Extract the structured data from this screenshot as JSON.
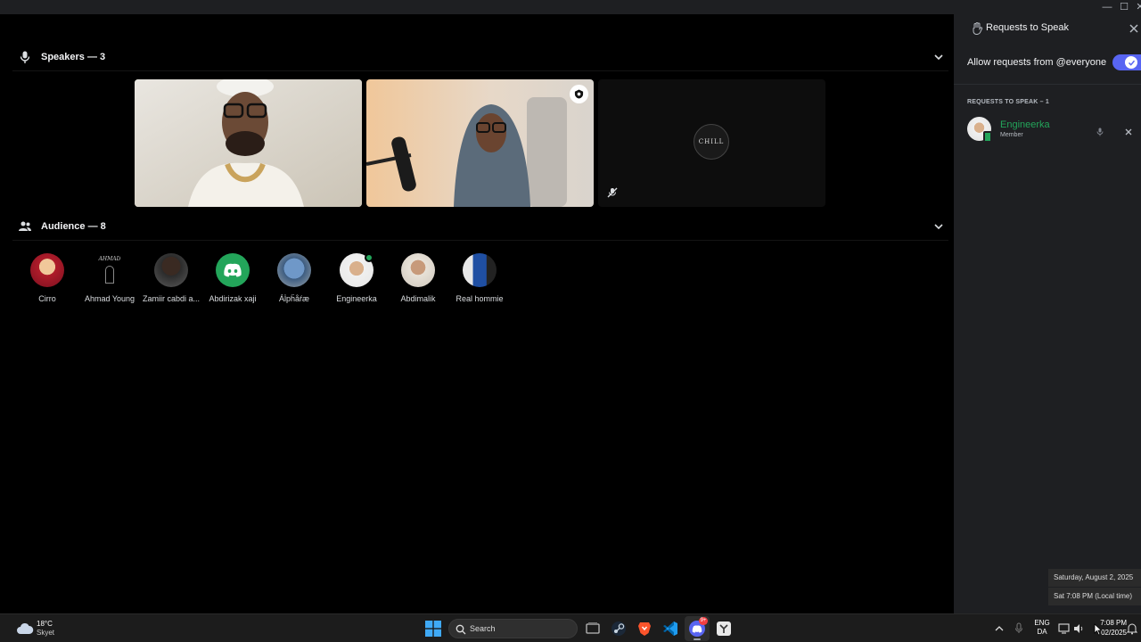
{
  "window": {
    "minimize_glyph": "—",
    "maximize_glyph": "☐",
    "close_glyph": "✕"
  },
  "stage": {
    "speakers_label": "Speakers — 3",
    "audience_label": "Audience — 8",
    "speakers": [
      {
        "name": "speaker-1",
        "kind": "video"
      },
      {
        "name": "speaker-2",
        "kind": "video",
        "badge": "moderator-shield-icon"
      },
      {
        "name": "speaker-3",
        "kind": "avatar",
        "avatar_text": "CHILL",
        "muted": true
      }
    ],
    "audience": [
      {
        "name": "Cirro"
      },
      {
        "name": "Ahmad Young",
        "avatar_text": "AHMAD"
      },
      {
        "name": "Zamiir cabdi a..."
      },
      {
        "name": "Abdirizak xaji"
      },
      {
        "name": "Áĺpĥåŕæ"
      },
      {
        "name": "Engineerka"
      },
      {
        "name": "Abdimalik"
      },
      {
        "name": "Real hommie"
      }
    ]
  },
  "panel": {
    "title": "Requests to Speak",
    "allow_label": "Allow requests from @everyone",
    "allow_enabled": true,
    "requests_header": "REQUESTS TO SPEAK – 1",
    "requests": [
      {
        "name": "Engineerka",
        "role": "Member"
      }
    ]
  },
  "taskbar": {
    "weather_temp": "18°C",
    "weather_desc": "Skyet",
    "search_placeholder": "Search",
    "discord_badge": "9+",
    "lang_top": "ENG",
    "lang_bottom": "DA",
    "clock_time": "7:08 PM",
    "clock_date": "02/2025",
    "tooltip_date": "Saturday, August 2, 2025",
    "tooltip_local": "Sat 7:08 PM (Local time)"
  },
  "colors": {
    "accent": "#5865f2",
    "member_green": "#23a55a",
    "panel_bg": "#1e1f22",
    "stage_bg": "#000000"
  }
}
